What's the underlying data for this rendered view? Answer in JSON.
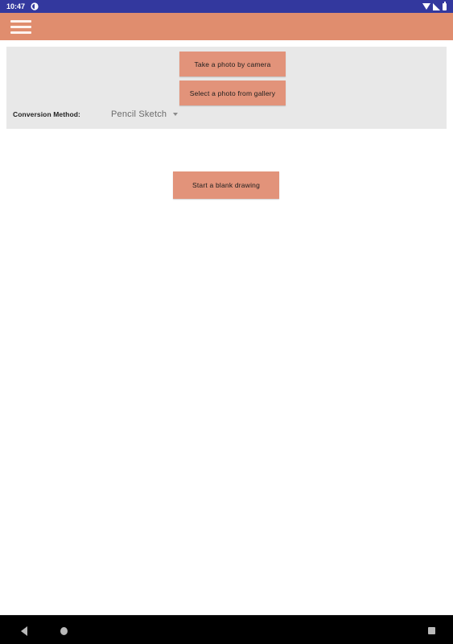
{
  "status_bar": {
    "clock": "10:47",
    "notification_icon": "circle-notification-icon",
    "wifi_icon": "wifi-icon",
    "signal_icon": "cellular-signal-icon",
    "battery_icon": "battery-icon",
    "background_color": "#33389e"
  },
  "app_bar": {
    "menu_icon": "hamburger-menu-icon",
    "background_color": "#e08d6e"
  },
  "main": {
    "panel": {
      "background_color": "#e8e8e8",
      "camera_button_label": "Take a photo by camera",
      "gallery_button_label": "Select a photo from gallery",
      "conversion_method_label": "Conversion Method:",
      "conversion_method_value": "Pencil Sketch",
      "conversion_method_caret": "chevron-down-icon"
    },
    "blank_drawing_button_label": "Start a blank drawing",
    "button_color": "#e2937a"
  },
  "navigation_bar": {
    "back_icon": "back-triangle-icon",
    "home_icon": "home-circle-icon",
    "recents_icon": "recents-square-icon",
    "background_color": "#000000"
  }
}
